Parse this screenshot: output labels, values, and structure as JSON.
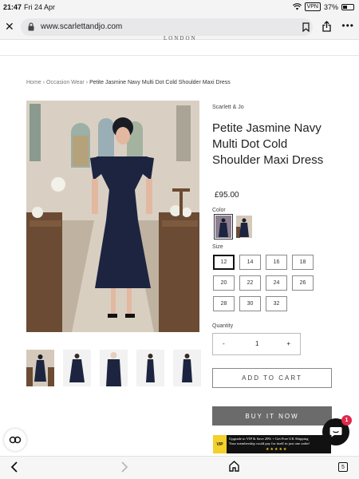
{
  "status_bar": {
    "time": "21:47",
    "date": "Fri 24 Apr",
    "vpn": "VPN",
    "battery": "37%",
    "battery_level": 0.37
  },
  "browser": {
    "url": "www.scarlettandjo.com"
  },
  "site": {
    "logo_fragment": "LONDON"
  },
  "breadcrumb": {
    "home": "Home",
    "category": "Occasion Wear",
    "current": "Petite Jasmine Navy Multi Dot Cold Shoulder Maxi Dress"
  },
  "product": {
    "brand": "Scarlett & Jo",
    "title": "Petite Jasmine Navy Multi Dot Cold Shoulder Maxi Dress",
    "price": "£95.00",
    "color_label": "Color",
    "size_label": "Size",
    "sizes": [
      "12",
      "14",
      "16",
      "18",
      "20",
      "22",
      "24",
      "26",
      "28",
      "30",
      "32"
    ],
    "selected_size": "12",
    "quantity_label": "Quantity",
    "quantity": "1",
    "qty_minus": "-",
    "qty_plus": "+",
    "add_to_cart": "ADD TO CART",
    "buy_now": "BUY IT NOW"
  },
  "promo": {
    "vip": "VIP",
    "line1": "Upgrade to VIP & Save 20% + Get Free UK Shipping",
    "line2": "Your membership could pay for itself in just one order!",
    "stars": "★★★★★"
  },
  "chat": {
    "badge": "1"
  },
  "toolbar": {
    "tabs_count": "5"
  },
  "colors": {
    "navy": "#1c2440",
    "buy_now_bg": "#6b6b6b",
    "promo_bg": "#111111",
    "vip_yellow": "#f3d02c",
    "chat_badge": "#e0294a"
  },
  "icons": [
    "close-icon",
    "lock-icon",
    "bookmark-icon",
    "share-icon",
    "more-icon",
    "chat-icon",
    "accessibility-icon",
    "back-arrow-icon",
    "forward-arrow-icon",
    "home-icon",
    "tabs-icon",
    "wifi-icon",
    "battery-icon"
  ]
}
